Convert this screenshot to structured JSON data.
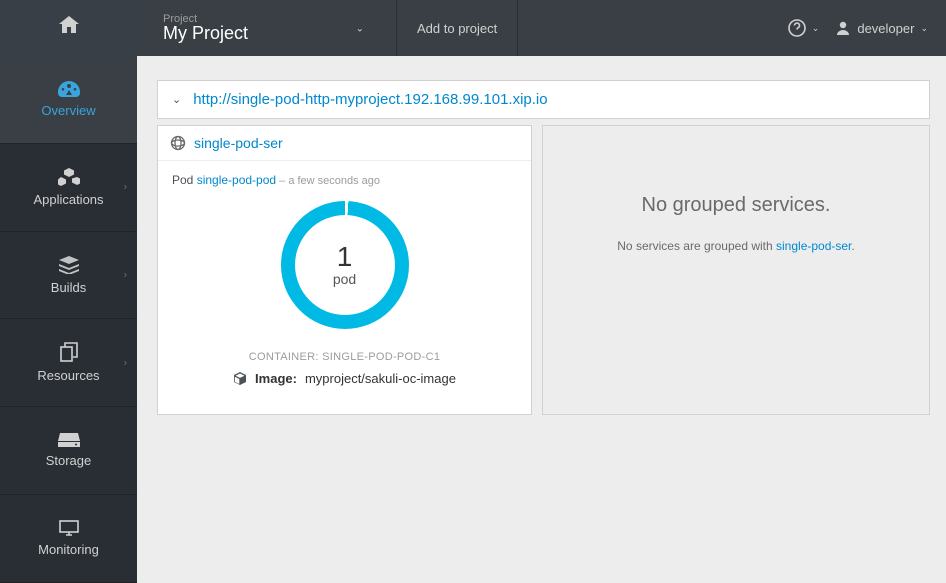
{
  "sidebar": {
    "items": [
      {
        "label": "Overview"
      },
      {
        "label": "Applications"
      },
      {
        "label": "Builds"
      },
      {
        "label": "Resources"
      },
      {
        "label": "Storage"
      },
      {
        "label": "Monitoring"
      }
    ]
  },
  "topbar": {
    "project_small": "Project",
    "project_name": "My Project",
    "add_to_project": "Add to project",
    "user": "developer"
  },
  "route": {
    "url": "http://single-pod-http-myproject.192.168.99.101.xip.io"
  },
  "service": {
    "name": "single-pod-ser",
    "pod_prefix": "Pod ",
    "pod_name": "single-pod-pod",
    "pod_time_sep": " – ",
    "pod_time": "a few seconds ago",
    "donut_count": "1",
    "donut_label": "pod",
    "container_label": "CONTAINER: SINGLE-POD-POD-C1",
    "image_label": "Image:",
    "image_value": "myproject/sakuli-oc-image"
  },
  "no_group": {
    "title": "No grouped services.",
    "text_prefix": "No services are grouped with ",
    "link": "single-pod-ser",
    "suffix": "."
  }
}
